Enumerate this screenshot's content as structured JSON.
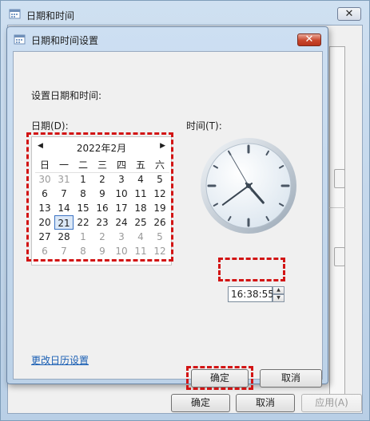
{
  "outer_window": {
    "title": "日期和时间",
    "close_label": "✕",
    "buttons": {
      "ok": "确定",
      "cancel": "取消",
      "apply": "应用(A)"
    }
  },
  "dialog": {
    "title": "日期和时间设置",
    "close_label": "✕",
    "heading": "设置日期和时间:",
    "date_label": "日期(D):",
    "time_label": "时间(T):",
    "calendar": {
      "month_title": "2022年2月",
      "prev_label": "◀",
      "next_label": "▶",
      "weekday_headers": [
        "日",
        "一",
        "二",
        "三",
        "四",
        "五",
        "六"
      ],
      "weeks": [
        [
          "30",
          "31",
          "1",
          "2",
          "3",
          "4",
          "5"
        ],
        [
          "6",
          "7",
          "8",
          "9",
          "10",
          "11",
          "12"
        ],
        [
          "13",
          "14",
          "15",
          "16",
          "17",
          "18",
          "19"
        ],
        [
          "20",
          "21",
          "22",
          "23",
          "24",
          "25",
          "26"
        ],
        [
          "27",
          "28",
          "1",
          "2",
          "3",
          "4",
          "5"
        ],
        [
          "6",
          "7",
          "8",
          "9",
          "10",
          "11",
          "12"
        ]
      ],
      "selected_day": "21"
    },
    "clock": {
      "hour": 16,
      "minute": 38,
      "second": 55
    },
    "time_value": "16:38:55",
    "change_calendar_link": "更改日历设置",
    "ok_button": "确定",
    "cancel_button": "取消"
  },
  "colors": {
    "highlight": "#d21414",
    "link": "#1a5fb4",
    "accent": "#3b73c4"
  },
  "icons": {
    "window": "calendar-clock-icon",
    "close": "close-icon"
  }
}
